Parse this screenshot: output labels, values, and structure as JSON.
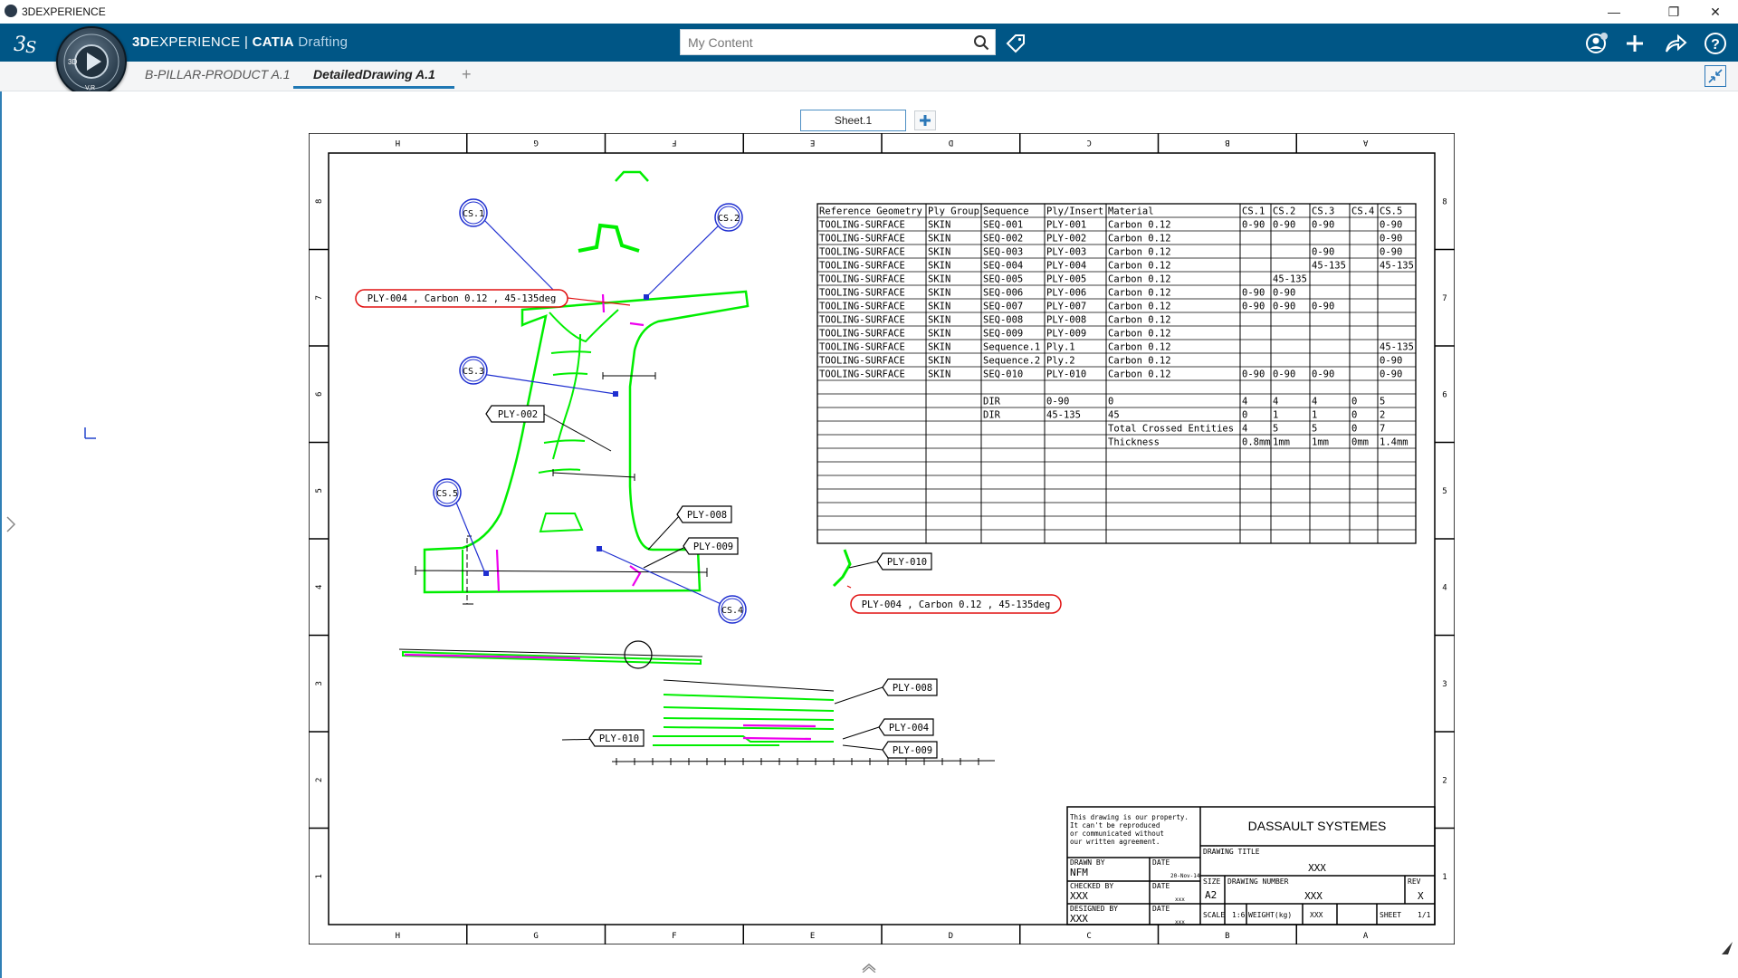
{
  "window": {
    "title": "3DEXPERIENCE",
    "minimize_glyph": "—",
    "restore_glyph": "❐",
    "close_glyph": "✕"
  },
  "topbar": {
    "brand_3d": "3D",
    "brand_experience": "EXPERIENCE",
    "brand_sep": " | ",
    "brand_catia": "CATIA",
    "brand_app": "Drafting",
    "search_placeholder": "My Content",
    "icons": [
      "search-icon",
      "tag-icon",
      "user-icon",
      "add-icon",
      "share-icon",
      "help-icon"
    ],
    "accent_color": "#005686"
  },
  "compass": {
    "label_top": "3D",
    "label_bottom": "V,R"
  },
  "tabs": [
    {
      "label": "B-PILLAR-PRODUCT A.1",
      "active": false
    },
    {
      "label": "DetailedDrawing A.1",
      "active": true
    }
  ],
  "tab_add": "+",
  "sheet_tab": "Sheet.1",
  "drawing": {
    "column_letters": [
      "H",
      "G",
      "F",
      "E",
      "D",
      "C",
      "B",
      "A"
    ],
    "row_numbers": [
      "8",
      "7",
      "6",
      "5",
      "4",
      "3",
      "2",
      "1"
    ],
    "table_headers": [
      "Reference Geometry",
      "Ply Group",
      "Sequence",
      "Ply/Insert",
      "Material",
      "CS.1",
      "CS.2",
      "CS.3",
      "CS.4",
      "CS.5"
    ],
    "table_rows": [
      [
        "TOOLING-SURFACE",
        "SKIN",
        "SEQ-001",
        "PLY-001",
        "Carbon 0.12",
        "0-90",
        "0-90",
        "0-90",
        "",
        "0-90"
      ],
      [
        "TOOLING-SURFACE",
        "SKIN",
        "SEQ-002",
        "PLY-002",
        "Carbon 0.12",
        "",
        "",
        "",
        "",
        "0-90"
      ],
      [
        "TOOLING-SURFACE",
        "SKIN",
        "SEQ-003",
        "PLY-003",
        "Carbon 0.12",
        "",
        "",
        "0-90",
        "",
        "0-90"
      ],
      [
        "TOOLING-SURFACE",
        "SKIN",
        "SEQ-004",
        "PLY-004",
        "Carbon 0.12",
        "",
        "",
        "45-135",
        "",
        "45-135"
      ],
      [
        "TOOLING-SURFACE",
        "SKIN",
        "SEQ-005",
        "PLY-005",
        "Carbon 0.12",
        "",
        "45-135",
        "",
        "",
        ""
      ],
      [
        "TOOLING-SURFACE",
        "SKIN",
        "SEQ-006",
        "PLY-006",
        "Carbon 0.12",
        "0-90",
        "0-90",
        "",
        "",
        ""
      ],
      [
        "TOOLING-SURFACE",
        "SKIN",
        "SEQ-007",
        "PLY-007",
        "Carbon 0.12",
        "0-90",
        "0-90",
        "0-90",
        "",
        ""
      ],
      [
        "TOOLING-SURFACE",
        "SKIN",
        "SEQ-008",
        "PLY-008",
        "Carbon 0.12",
        "",
        "",
        "",
        "",
        ""
      ],
      [
        "TOOLING-SURFACE",
        "SKIN",
        "SEQ-009",
        "PLY-009",
        "Carbon 0.12",
        "",
        "",
        "",
        "",
        ""
      ],
      [
        "TOOLING-SURFACE",
        "SKIN",
        "Sequence.1",
        "Ply.1",
        "Carbon 0.12",
        "",
        "",
        "",
        "",
        "45-135"
      ],
      [
        "TOOLING-SURFACE",
        "SKIN",
        "Sequence.2",
        "Ply.2",
        "Carbon 0.12",
        "",
        "",
        "",
        "",
        "0-90"
      ],
      [
        "TOOLING-SURFACE",
        "SKIN",
        "SEQ-010",
        "PLY-010",
        "Carbon 0.12",
        "0-90",
        "0-90",
        "0-90",
        "",
        "0-90"
      ],
      [
        "",
        "",
        "",
        "",
        "",
        "",
        "",
        "",
        "",
        ""
      ],
      [
        "",
        "",
        "DIR",
        "0-90",
        "0",
        "4",
        "4",
        "4",
        "0",
        "5"
      ],
      [
        "",
        "",
        "DIR",
        "45-135",
        "45",
        "0",
        "1",
        "1",
        "0",
        "2"
      ],
      [
        "",
        "",
        "",
        "",
        "Total Crossed Entities",
        "4",
        "5",
        "5",
        "0",
        "7"
      ],
      [
        "",
        "",
        "",
        "",
        "Thickness",
        "0.8mm",
        "1mm",
        "1mm",
        "0mm",
        "1.4mm"
      ],
      [
        "",
        "",
        "",
        "",
        "",
        "",
        "",
        "",
        "",
        ""
      ],
      [
        "",
        "",
        "",
        "",
        "",
        "",
        "",
        "",
        "",
        ""
      ],
      [
        "",
        "",
        "",
        "",
        "",
        "",
        "",
        "",
        "",
        ""
      ],
      [
        "",
        "",
        "",
        "",
        "",
        "",
        "",
        "",
        "",
        ""
      ],
      [
        "",
        "",
        "",
        "",
        "",
        "",
        "",
        "",
        "",
        ""
      ],
      [
        "",
        "",
        "",
        "",
        "",
        "",
        "",
        "",
        "",
        ""
      ],
      [
        "",
        "",
        "",
        "",
        "",
        "",
        "",
        "",
        "",
        ""
      ]
    ],
    "callouts": {
      "cs1": "CS.1",
      "cs2": "CS.2",
      "cs3": "CS.3",
      "cs4": "CS.4",
      "cs5": "CS.5",
      "ply004_top": "PLY-004 , Carbon 0.12 , 45-135deg",
      "ply002": "PLY-002",
      "ply008": "PLY-008",
      "ply009": "PLY-009",
      "ply010": "PLY-010",
      "ply004_mid": "PLY-004 , Carbon 0.12 , 45-135deg",
      "ply004_bottom": "PLY-004",
      "ply008_bottom": "PLY-008",
      "ply009_bottom": "PLY-009",
      "ply010_bottom": "PLY-010"
    },
    "title_block": {
      "notice_1": "This drawing is our property.",
      "notice_2": "It can't be reproduced",
      "notice_3": "or communicated without",
      "notice_4": "our written agreement.",
      "company": "DASSAULT SYSTEMES",
      "drawing_title_label": "DRAWING TITLE",
      "drawing_title_value": "XXX",
      "drawn_by_label": "DRAWN BY",
      "drawn_by_value": "NFM",
      "date_label": "DATE",
      "date_value": "20-Nov-14",
      "checked_by_label": "CHECKED BY",
      "checked_by_value": "XXX",
      "date2_label": "DATE",
      "date2_value": "xxx",
      "designed_by_label": "DESIGNED BY",
      "designed_by_value": "XXX",
      "date3_label": "DATE",
      "date3_value": "xxx",
      "size_label": "SIZE",
      "size_value": "A2",
      "drawing_number_label": "DRAWING NUMBER",
      "drawing_number_value": "XXX",
      "rev_label": "REV",
      "rev_value": "X",
      "scale_label": "SCALE",
      "scale_value": "1:6",
      "weight_label": "WEIGHT(kg)",
      "weight_value": "XXX",
      "sheet_label": "SHEET",
      "sheet_value": "1/1"
    },
    "colors": {
      "geometry": "#00ee00",
      "ply_highlight": "#ee00ee",
      "cs_marker": "#1f2fd0",
      "ply004_callout": "#e01010"
    }
  }
}
